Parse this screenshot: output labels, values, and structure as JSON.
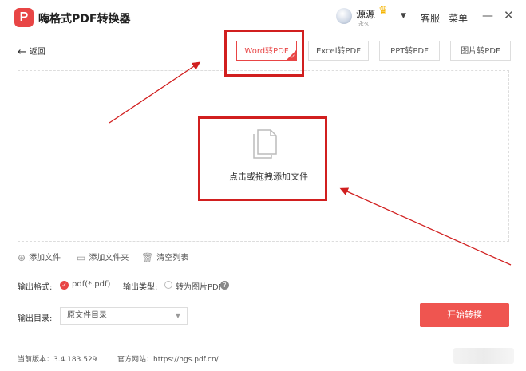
{
  "app": {
    "logo_letter": "P",
    "title": "嗨格式PDF转换器"
  },
  "user": {
    "name": "源源",
    "sub": "永久"
  },
  "nav": {
    "service": "客服",
    "menu": "菜单",
    "minimize": "—",
    "close": "✕"
  },
  "back_label": "返回",
  "tabs": [
    {
      "label": "Word转PDF",
      "active": true
    },
    {
      "label": "Excel转PDF",
      "active": false
    },
    {
      "label": "PPT转PDF",
      "active": false
    },
    {
      "label": "图片转PDF",
      "active": false
    }
  ],
  "drop_area": {
    "prompt": "点击或拖拽添加文件"
  },
  "actions": [
    {
      "label": "添加文件",
      "icon": "plus-circle-icon"
    },
    {
      "label": "添加文件夹",
      "icon": "folder-icon"
    },
    {
      "label": "清空列表",
      "icon": "trash-icon"
    }
  ],
  "output": {
    "format_label": "输出格式:",
    "format_value": "pdf(*.pdf)",
    "type_label": "输出类型:",
    "type_value": "转为图片PDF",
    "dir_label": "输出目录:",
    "dir_value": "原文件目录"
  },
  "start_button": "开始转换",
  "footer": {
    "version": "当前版本：3.4.183.529",
    "website": "官方网站：https://hgs.pdf.cn/"
  },
  "colors": {
    "accent": "#e84545",
    "annotation": "#d11f1f"
  }
}
